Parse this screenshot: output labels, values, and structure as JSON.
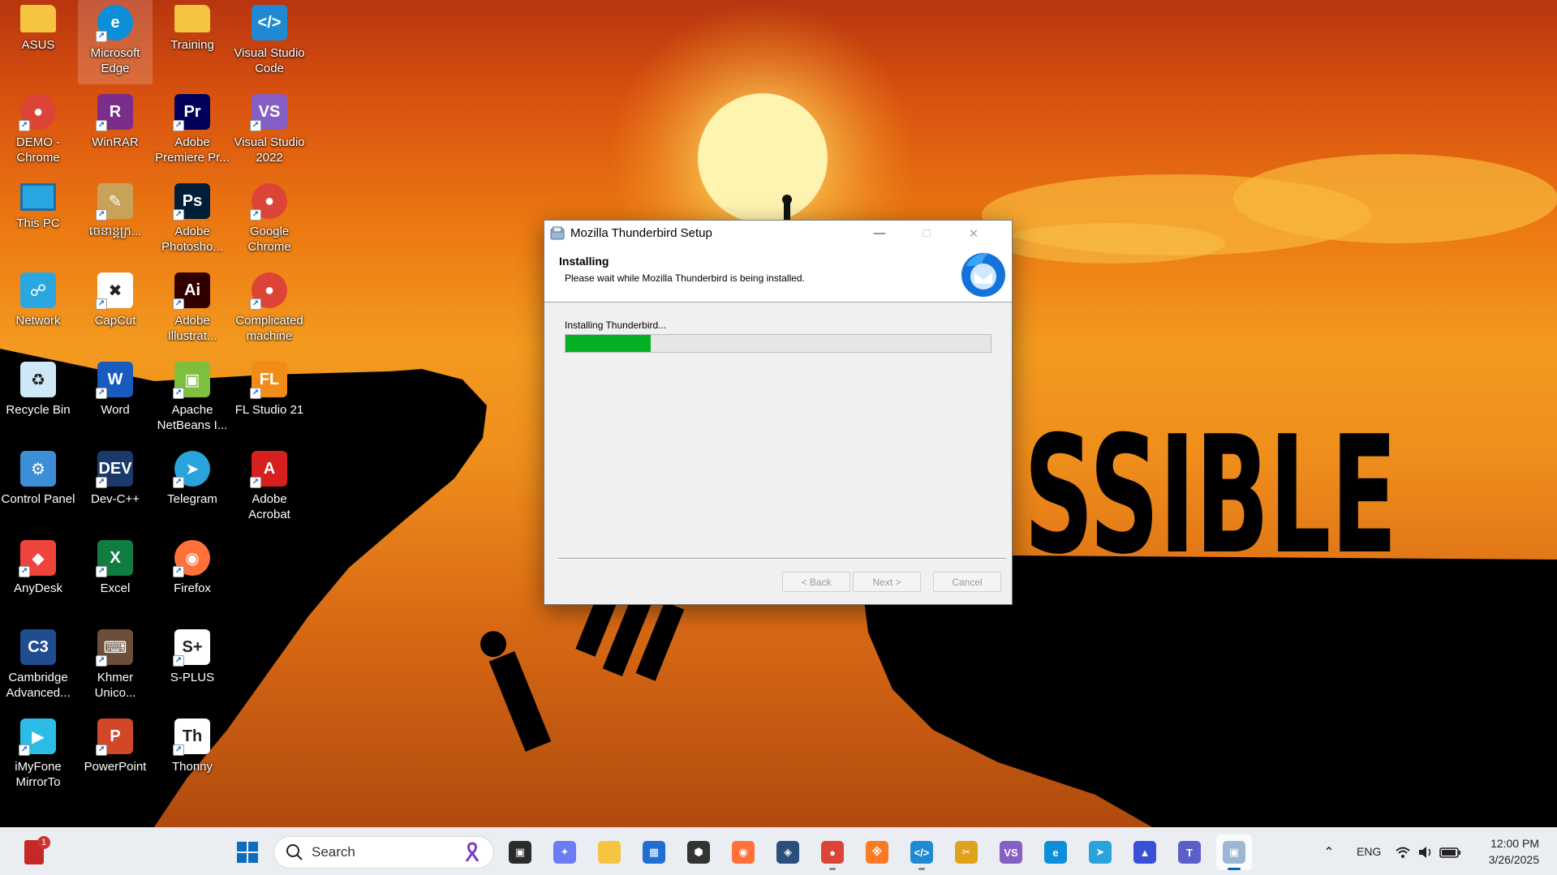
{
  "desktop": {
    "icons": [
      {
        "label": "ASUS",
        "icon": "folder-icon",
        "color": "#f5c542"
      },
      {
        "label": "Microsoft Edge",
        "icon": "edge-icon",
        "color": "#0c8ed9"
      },
      {
        "label": "Training",
        "icon": "folder-icon",
        "color": "#f5c542"
      },
      {
        "label": "Visual Studio Code",
        "icon": "vscode-icon",
        "color": "#1f8ad2"
      },
      {
        "label": "DEMO - Chrome",
        "icon": "chrome-icon",
        "color": "#db4437"
      },
      {
        "label": "WinRAR",
        "icon": "winrar-icon",
        "color": "#7b2d8c"
      },
      {
        "label": "Adobe Premiere Pr...",
        "icon": "premiere-icon",
        "color": "#00005b"
      },
      {
        "label": "Visual Studio 2022",
        "icon": "visual-studio-icon",
        "color": "#865fc5"
      },
      {
        "label": "This PC",
        "icon": "monitor-icon",
        "color": "#2aa7e0"
      },
      {
        "label": "ចេនាន្តក្រ...",
        "icon": "document-icon",
        "color": "#c9a25a"
      },
      {
        "label": "Adobe Photosho...",
        "icon": "photoshop-icon",
        "color": "#001e36"
      },
      {
        "label": "Google Chrome",
        "icon": "chrome-icon",
        "color": "#db4437"
      },
      {
        "label": "Network",
        "icon": "network-icon",
        "color": "#2aa7e0"
      },
      {
        "label": "CapCut",
        "icon": "capcut-icon",
        "color": "#ffffff"
      },
      {
        "label": "Adobe Illustrat...",
        "icon": "illustrator-icon",
        "color": "#330000"
      },
      {
        "label": "Complicated machine",
        "icon": "chrome-icon",
        "color": "#db4437"
      },
      {
        "label": "Recycle Bin",
        "icon": "recycle-bin-icon",
        "color": "#cfe8f7"
      },
      {
        "label": "Word",
        "icon": "word-icon",
        "color": "#185abd"
      },
      {
        "label": "Apache NetBeans I...",
        "icon": "netbeans-icon",
        "color": "#7fbf3f"
      },
      {
        "label": "FL Studio 21",
        "icon": "fl-studio-icon",
        "color": "#f28c18"
      },
      {
        "label": "Control Panel",
        "icon": "control-panel-icon",
        "color": "#3c8fd6"
      },
      {
        "label": "Dev-C++",
        "icon": "devcpp-icon",
        "color": "#1b3a6b"
      },
      {
        "label": "Telegram",
        "icon": "telegram-icon",
        "color": "#2aa3dd"
      },
      {
        "label": "Adobe Acrobat",
        "icon": "acrobat-icon",
        "color": "#d6201f"
      },
      {
        "label": "AnyDesk",
        "icon": "anydesk-icon",
        "color": "#ef443b"
      },
      {
        "label": "Excel",
        "icon": "excel-icon",
        "color": "#107c41"
      },
      {
        "label": "Firefox",
        "icon": "firefox-icon",
        "color": "#ff7139"
      },
      {
        "label": "",
        "icon": "",
        "color": ""
      },
      {
        "label": "Cambridge Advanced...",
        "icon": "cald3-icon",
        "color": "#1f4d8f"
      },
      {
        "label": "Khmer Unico...",
        "icon": "keyboard-icon",
        "color": "#6b4f3a"
      },
      {
        "label": "S-PLUS",
        "icon": "splus-icon",
        "color": "#ffffff"
      },
      {
        "label": "",
        "icon": "",
        "color": ""
      },
      {
        "label": "iMyFone MirrorTo",
        "icon": "mirrorto-icon",
        "color": "#2dbce8"
      },
      {
        "label": "PowerPoint",
        "icon": "powerpoint-icon",
        "color": "#d24726"
      },
      {
        "label": "Thonny",
        "icon": "thonny-icon",
        "color": "#ffffff"
      }
    ]
  },
  "dialog": {
    "title": "Mozilla Thunderbird Setup",
    "header_title": "Installing",
    "header_subtitle": "Please wait while Mozilla Thunderbird is being installed.",
    "status": "Installing Thunderbird...",
    "progress": 0.2,
    "buttons": {
      "back": "< Back",
      "next": "Next >",
      "cancel": "Cancel"
    },
    "accent": "#06b025"
  },
  "taskbar": {
    "search_label": "Search",
    "language": "ENG",
    "time": "12:00 PM",
    "date": "3/26/2025",
    "notification_count": "1"
  }
}
